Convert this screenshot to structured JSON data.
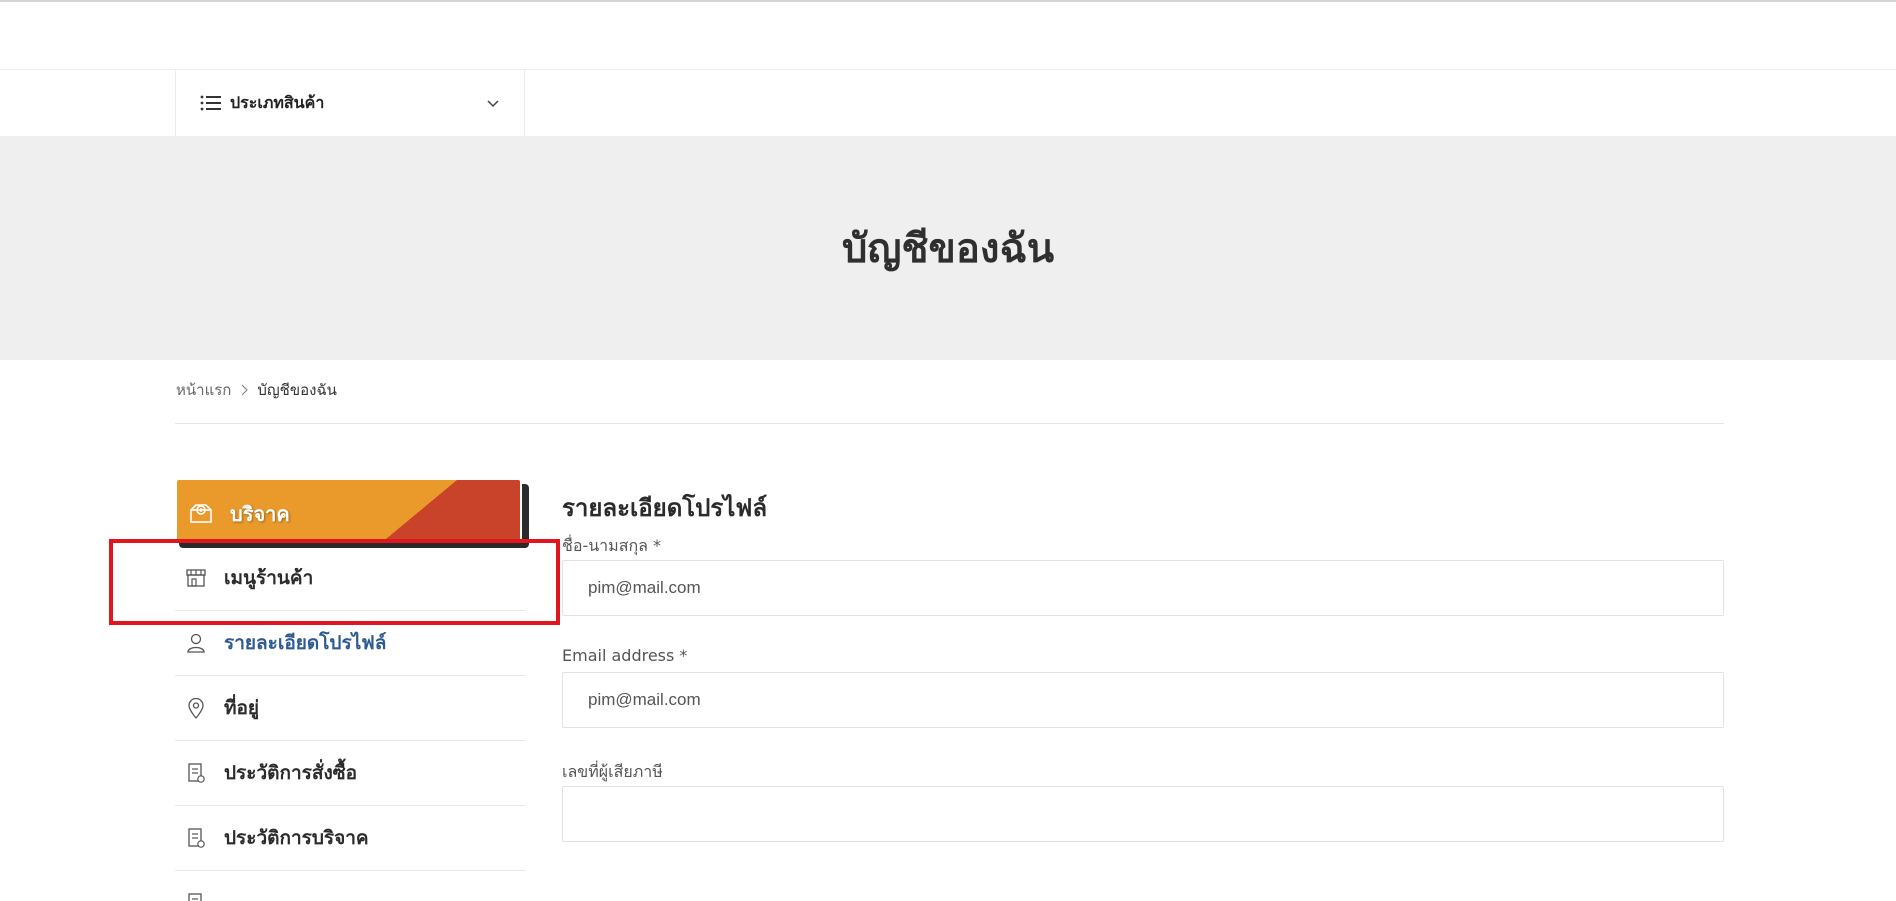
{
  "header": {
    "category_label": "ประเภทสินค้า"
  },
  "hero": {
    "title": "บัญชีของฉัน"
  },
  "breadcrumb": {
    "home": "หน้าแรก",
    "current": "บัญชีของฉัน"
  },
  "sidebar": {
    "donate_label": "บริจาค",
    "items": [
      {
        "label": "เมนูร้านค้า",
        "icon": "store-icon"
      },
      {
        "label": "รายละเอียดโปรไฟล์",
        "icon": "user-icon",
        "active": true
      },
      {
        "label": "ที่อยู่",
        "icon": "map-pin-icon"
      },
      {
        "label": "ประวัติการสั่งซื้อ",
        "icon": "receipt-icon"
      },
      {
        "label": "ประวัติการบริจาค",
        "icon": "receipt-icon"
      }
    ]
  },
  "profile": {
    "heading": "รายละเอียดโปรไฟล์",
    "fields": [
      {
        "label": "ชื่อ-นามสกุล *",
        "value": "pim@mail.com"
      },
      {
        "label": "Email address *",
        "value": "pim@mail.com"
      },
      {
        "label": "เลขที่ผู้เสียภาษี",
        "value": ""
      }
    ]
  },
  "colors": {
    "donate_orange": "#e99a2a",
    "donate_red": "#c8432a",
    "active_blue": "#2f5b92",
    "highlight_red": "#e0151d"
  }
}
